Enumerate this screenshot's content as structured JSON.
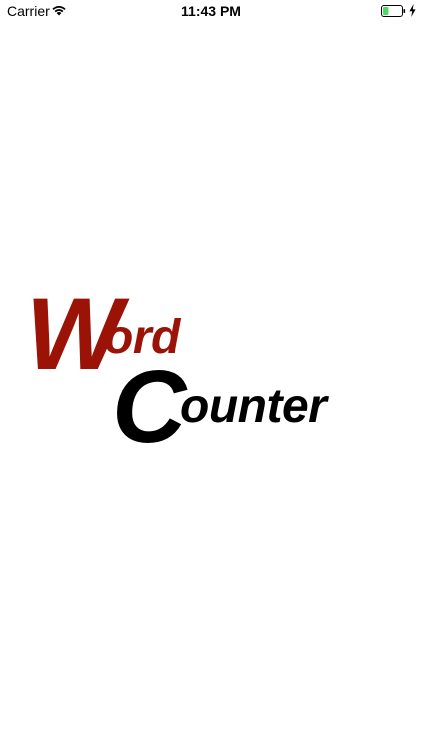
{
  "status_bar": {
    "carrier": "Carrier",
    "time": "11:43 PM",
    "wifi_icon": "wifi-icon",
    "battery_icon": "battery-icon",
    "charging_icon": "charging-bolt-icon",
    "battery_level": 0.3,
    "battery_fill_color": "#4cd964"
  },
  "logo": {
    "word_first_letter": "W",
    "word_rest": "ord",
    "counter_first_letter": "C",
    "counter_rest": "ounter",
    "word_color": "#9b1306",
    "counter_color": "#000000"
  },
  "colors": {
    "background": "#ffffff"
  }
}
